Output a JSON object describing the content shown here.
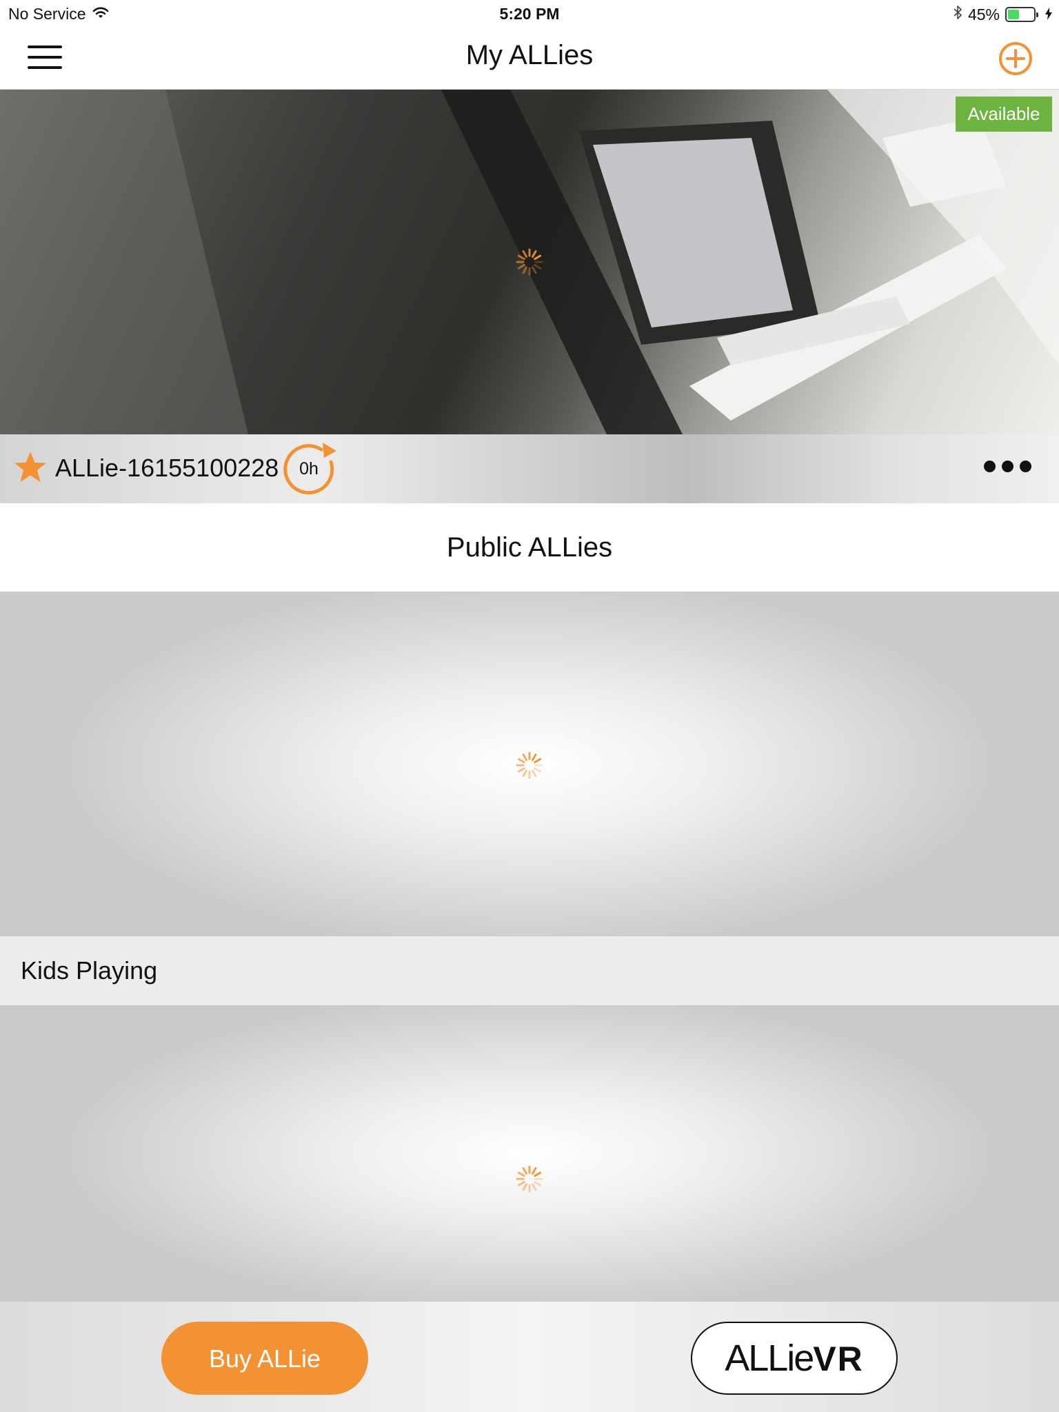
{
  "status_bar": {
    "carrier": "No Service",
    "time": "5:20 PM",
    "battery_percent": "45%",
    "battery_level": 0.45,
    "icons": [
      "wifi-icon",
      "bluetooth-icon",
      "battery-icon",
      "charging-bolt-icon"
    ]
  },
  "nav": {
    "title": "My ALLies",
    "menu_icon": "hamburger-menu-icon",
    "add_icon": "plus-circle-icon"
  },
  "my_camera": {
    "name": "ALLie-16155100228",
    "status_badge": "Available",
    "timer_label": "0h",
    "favorite_icon": "star-icon",
    "more_icon": "more-dots-icon"
  },
  "public_section": {
    "title": "Public ALLies",
    "items": [
      {
        "label": "Kids Playing"
      }
    ]
  },
  "bottom_bar": {
    "buy_label": "Buy  ALLie",
    "vr_logo_part1": "ALLie",
    "vr_logo_part2": "VR"
  },
  "colors": {
    "accent": "#f39234",
    "available_green": "#6db33f"
  }
}
